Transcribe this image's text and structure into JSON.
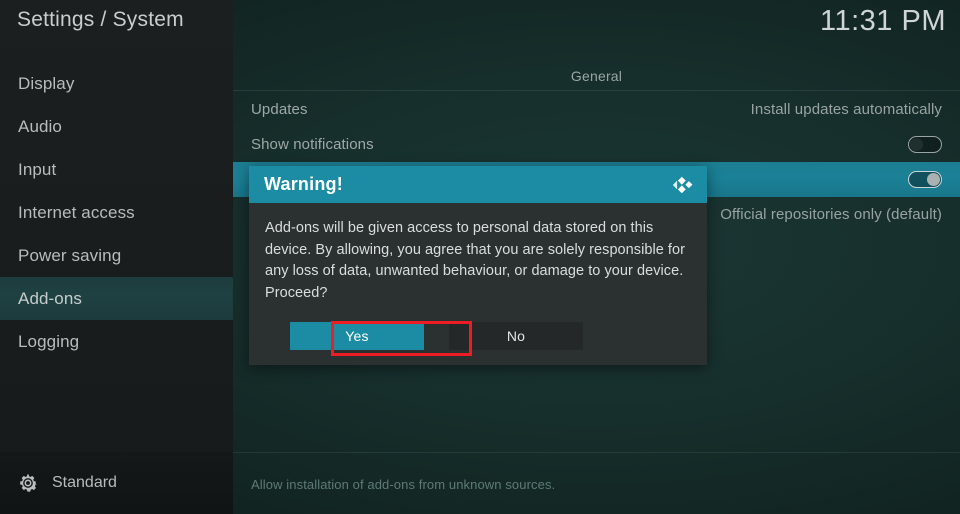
{
  "sidebar": {
    "title": "Settings / System",
    "items": [
      {
        "label": "Display",
        "selected": false
      },
      {
        "label": "Audio",
        "selected": false
      },
      {
        "label": "Input",
        "selected": false
      },
      {
        "label": "Internet access",
        "selected": false
      },
      {
        "label": "Power saving",
        "selected": false
      },
      {
        "label": "Add-ons",
        "selected": true
      },
      {
        "label": "Logging",
        "selected": false
      }
    ],
    "profile": {
      "icon": "gear-icon",
      "label": "Standard"
    }
  },
  "header": {
    "clock": "11:31 PM"
  },
  "main": {
    "category": "General",
    "rows": [
      {
        "label": "Updates",
        "value": "Install updates automatically",
        "control": "text",
        "highlight": false
      },
      {
        "label": "Show notifications",
        "value": "",
        "control": "toggle",
        "toggle_state": "off",
        "highlight": false
      },
      {
        "label": "",
        "value": "",
        "control": "toggle",
        "toggle_state": "on",
        "highlight": true
      },
      {
        "label": "",
        "value": "Official repositories only (default)",
        "control": "text",
        "highlight": false
      }
    ],
    "help_text": "Allow installation of add-ons from unknown sources."
  },
  "dialog": {
    "title": "Warning!",
    "logo_icon": "kodi-logo-icon",
    "message": "Add-ons will be given access to personal data stored on this device. By allowing, you agree that you are solely responsible for any loss of data, unwanted behaviour, or damage to your device. Proceed?",
    "buttons": {
      "confirm": "Yes",
      "cancel": "No"
    }
  },
  "annotation": {
    "target": "Yes",
    "color": "#ee1c23"
  },
  "colors": {
    "accent_teal": "#1b8ca3",
    "sidebar_bg": "#191d1d",
    "content_bg": "#17302e",
    "dialog_bg": "#2b3030",
    "highlight_row": "#1b8197",
    "annotation_red": "#ee1c23"
  }
}
